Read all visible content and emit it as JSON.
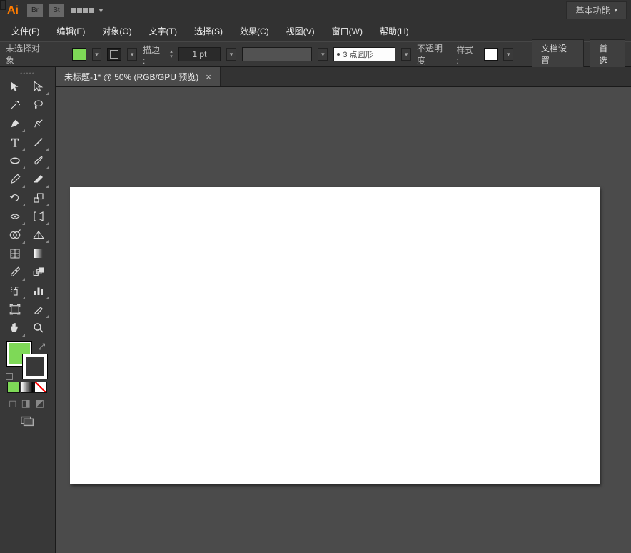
{
  "appbar": {
    "logo": "Ai",
    "br": "Br",
    "st": "St",
    "workspace_label": "基本功能"
  },
  "menu": {
    "file": "文件(F)",
    "edit": "编辑(E)",
    "object": "对象(O)",
    "type": "文字(T)",
    "select": "选择(S)",
    "effect": "效果(C)",
    "view": "视图(V)",
    "window": "窗口(W)",
    "help": "帮助(H)"
  },
  "control": {
    "selection_status": "未选择对象",
    "stroke_label": "描边 :",
    "stroke_value": "1 pt",
    "dash_value": "3 点圆形",
    "opacity_label": "不透明度",
    "style_label": "样式 :",
    "doc_setup": "文档设置",
    "prefs": "首选"
  },
  "doc": {
    "tab_title": "未标题-1* @ 50% (RGB/GPU 预览)"
  },
  "colors": {
    "fill": "#7ed957"
  },
  "tools": {
    "selection": "selection-tool",
    "direct_selection": "direct-selection-tool",
    "magic_wand": "magic-wand-tool",
    "lasso": "lasso-tool",
    "pen": "pen-tool",
    "curvature": "curvature-tool",
    "type": "type-tool",
    "line": "line-tool",
    "ellipse": "ellipse-tool",
    "paintbrush": "paintbrush-tool",
    "pencil": "pencil-tool",
    "eraser": "eraser-tool",
    "rotate": "rotate-tool",
    "scale": "scale-tool",
    "width": "width-tool",
    "free_transform": "free-transform-tool",
    "shape_builder": "shape-builder-tool",
    "perspective": "perspective-tool",
    "mesh": "mesh-tool",
    "gradient": "gradient-tool",
    "eyedropper": "eyedropper-tool",
    "blend": "blend-tool",
    "symbol_sprayer": "symbol-sprayer-tool",
    "column_graph": "column-graph-tool",
    "artboard": "artboard-tool",
    "slice": "slice-tool",
    "hand": "hand-tool",
    "zoom": "zoom-tool"
  }
}
